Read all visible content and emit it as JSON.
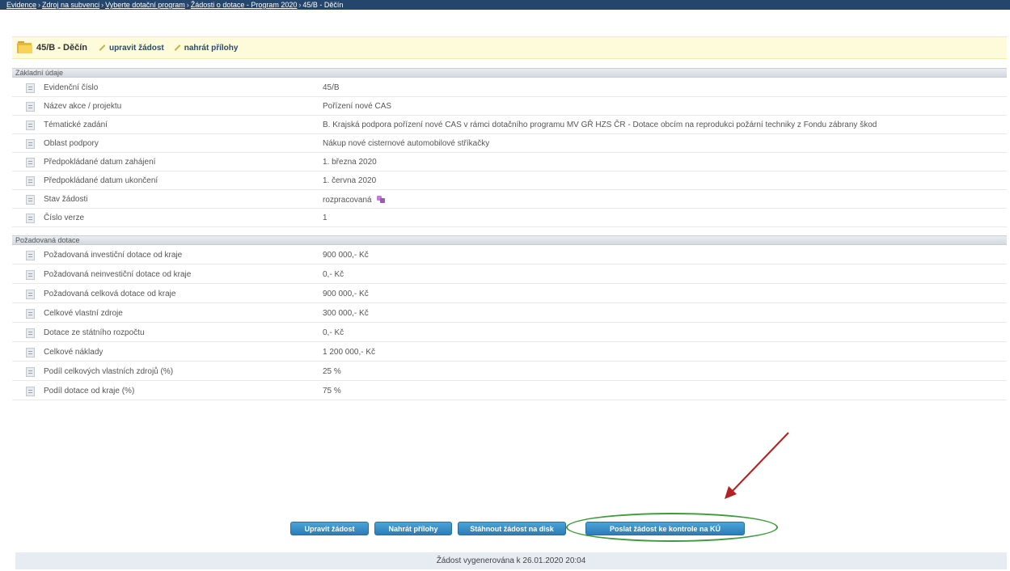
{
  "breadcrumb": {
    "items": [
      "Evidence",
      "Zdroj na subvenci",
      "Vyberte dotační program",
      "Žádosti o dotace - Program 2020",
      "45/B - Děčín"
    ],
    "separator": "›"
  },
  "header": {
    "title": "45/B - Děčín",
    "link_edit": "upravit žádost",
    "link_attach": "nahrát přílohy"
  },
  "sections": {
    "basic": {
      "title": "Základní údaje",
      "rows": [
        {
          "label": "Evidenční číslo",
          "value": "45/B"
        },
        {
          "label": "Název akce / projektu",
          "value": "Pořízení nové CAS"
        },
        {
          "label": "Tématické zadání",
          "value": "B. Krajská podpora pořízení nové CAS v rámci dotačního programu MV GŘ HZS ČR - Dotace obcím na reprodukci požární techniky z Fondu zábrany škod"
        },
        {
          "label": "Oblast podpory",
          "value": "Nákup nové cisternové automobilové stříkačky"
        },
        {
          "label": "Předpokládané datum zahájení",
          "value": "1. března 2020"
        },
        {
          "label": "Předpokládané datum ukončení",
          "value": "1. června 2020"
        },
        {
          "label": "Stav žádosti",
          "value": "rozpracovaná"
        },
        {
          "label": "Číslo verze",
          "value": "1"
        }
      ]
    },
    "subsidy": {
      "title": "Požadovaná dotace",
      "rows": [
        {
          "label": "Požadovaná investiční dotace od kraje",
          "value": "900 000,- Kč"
        },
        {
          "label": "Požadovaná neinvestiční dotace od kraje",
          "value": "0,- Kč"
        },
        {
          "label": "Požadovaná celková dotace od kraje",
          "value": "900 000,- Kč"
        },
        {
          "label": "Celkové vlastní zdroje",
          "value": "300 000,- Kč"
        },
        {
          "label": "Dotace ze státního rozpočtu",
          "value": "0,- Kč"
        },
        {
          "label": "Celkové náklady",
          "value": "1 200 000,- Kč"
        },
        {
          "label": "Podíl celkových vlastních zdrojů (%)",
          "value": "25 %"
        },
        {
          "label": "Podíl dotace od kraje (%)",
          "value": "75 %"
        }
      ]
    }
  },
  "buttons": {
    "edit": "Upravit žádost",
    "attach": "Nahrát přílohy",
    "download": "Stáhnout žádost na disk",
    "send": "Poslat žádost ke kontrole na KÚ"
  },
  "footer": {
    "text": "Žádost vygenerována k 26.01.2020 20:04"
  },
  "colors": {
    "breadcrumb_bg": "#24466c",
    "title_bg": "#fdfbd9",
    "button_blue": "#2c7db5",
    "highlight_green": "#3d9b3d",
    "arrow_red": "#b22222",
    "footer_bg": "#e7ebf2"
  }
}
